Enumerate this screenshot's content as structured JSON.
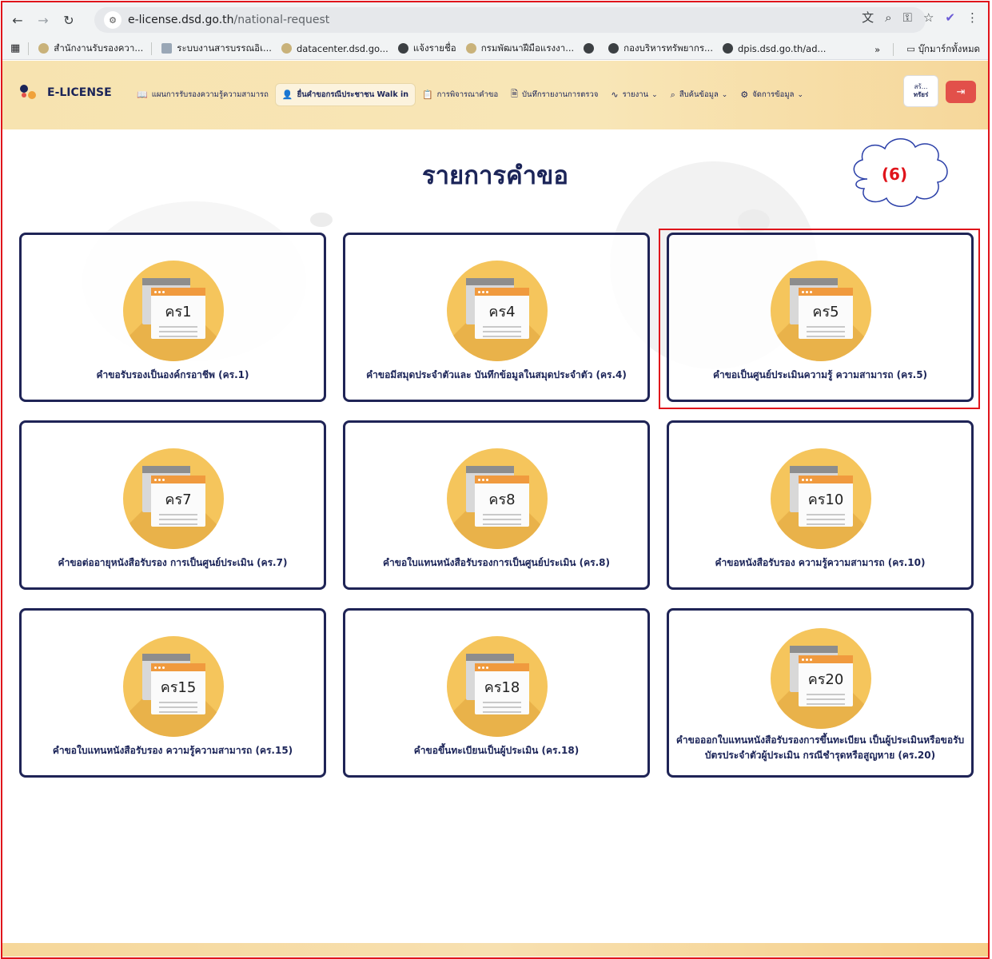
{
  "browser": {
    "url_domain": "e-license.dsd.go.th",
    "url_path": "/national-request",
    "bookmarks": [
      "สำนักงานรับรองควา...",
      "ระบบงานสารบรรณอิเ...",
      "datacenter.dsd.go...",
      "แจ้งรายชื่อ",
      "กรมพัฒนาฝีมือแรงงา...",
      "",
      "กองบริหารทรัพยากร...",
      "dpis.dsd.go.th/ad..."
    ],
    "more": "»",
    "all_bookmarks": "บุ๊กมาร์กทั้งหมด"
  },
  "header": {
    "logo_text": "E-LICENSE",
    "menu": [
      {
        "label": "แผนการรับรองความรู้ความสามารถ",
        "icon": "book-icon"
      },
      {
        "label": "ยื่นคำขอกรณีประชาชน Walk in",
        "icon": "add-user-icon"
      },
      {
        "label": "การพิจารณาคำขอ",
        "icon": "clipboard-icon"
      },
      {
        "label": "บันทึกรายงานการตรวจ",
        "icon": "document-icon"
      },
      {
        "label": "รายงาน",
        "icon": "activity-icon"
      },
      {
        "label": "สืบค้นข้อมูล",
        "icon": "search-icon"
      },
      {
        "label": "จัดการข้อมูล",
        "icon": "gear-icon"
      }
    ],
    "user_line1": "สร้...",
    "user_line2": "ทรัยร่"
  },
  "page": {
    "title": "รายการคำขอ",
    "annotation": "(6)"
  },
  "cards": [
    {
      "code": "คร1",
      "label": "คำขอรับรองเป็นองค์กรอาชีพ (คร.1)"
    },
    {
      "code": "คร4",
      "label": "คำขอมีสมุดประจำตัวและ บันทึกข้อมูลในสมุดประจำตัว (คร.4)"
    },
    {
      "code": "คร5",
      "label": "คำขอเป็นศูนย์ประเมินความรู้ ความสามารถ (คร.5)"
    },
    {
      "code": "คร7",
      "label": "คำขอต่ออายุหนังสือรับรอง การเป็นศูนย์ประเมิน (คร.7)"
    },
    {
      "code": "คร8",
      "label": "คำขอใบแทนหนังสือรับรองการเป็นศูนย์ประเมิน (คร.8)"
    },
    {
      "code": "คร10",
      "label": "คำขอหนังสือรับรอง ความรู้ความสามารถ (คร.10)"
    },
    {
      "code": "คร15",
      "label": "คำขอใบแทนหนังสือรับรอง ความรู้ความสามารถ (คร.15)"
    },
    {
      "code": "คร18",
      "label": "คำขอขึ้นทะเบียนเป็นผู้ประเมิน (คร.18)"
    },
    {
      "code": "คร20",
      "label": "คำขอออกใบแทนหนังสือรับรองการขึ้นทะเบียน เป็นผู้ประเมินหรือขอรับบัตรประจำตัวผู้ประเมิน กรณีชำรุดหรือสูญหาย (คร.20)"
    }
  ]
}
